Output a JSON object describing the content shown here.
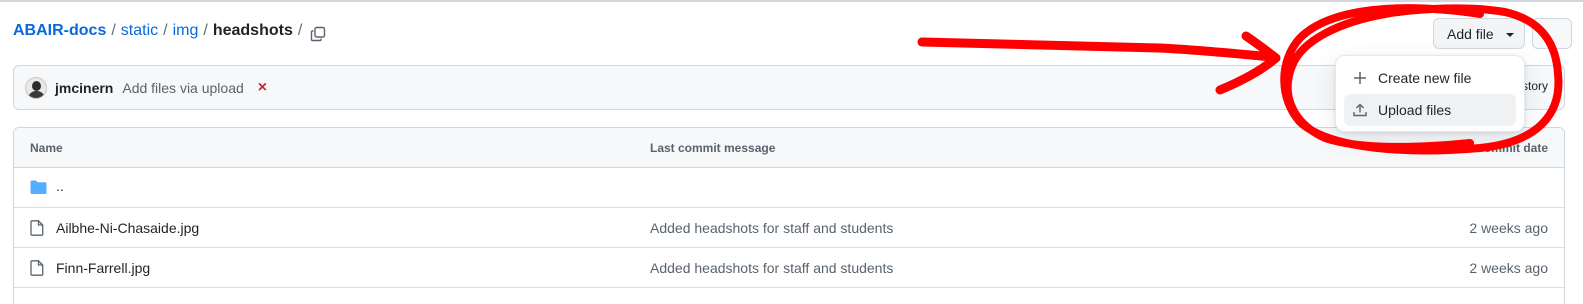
{
  "breadcrumb": {
    "repo": "ABAIR-docs",
    "segments": [
      "static",
      "img"
    ],
    "current": "headshots",
    "separator": "/"
  },
  "toolbar": {
    "add_file_label": "Add file"
  },
  "dropdown": {
    "items": [
      {
        "label": "Create new file",
        "icon": "plus-icon"
      },
      {
        "label": "Upload files",
        "icon": "upload-icon"
      }
    ]
  },
  "commit": {
    "user": "jmcinern",
    "message": "Add files via upload",
    "status": "×",
    "history_label": "story"
  },
  "table": {
    "headers": {
      "name": "Name",
      "message": "Last commit message",
      "date": "Last commit date"
    },
    "parent_dir": "..",
    "rows": [
      {
        "name": "Ailbhe-Ni-Chasaide.jpg",
        "message": "Added headshots for staff and students",
        "date": "2 weeks ago"
      },
      {
        "name": "Finn-Farrell.jpg",
        "message": "Added headshots for staff and students",
        "date": "2 weeks ago"
      }
    ]
  },
  "colors": {
    "link": "#0969da",
    "annotation": "#ff0000",
    "folder": "#54aeff",
    "error": "#d1242f"
  }
}
